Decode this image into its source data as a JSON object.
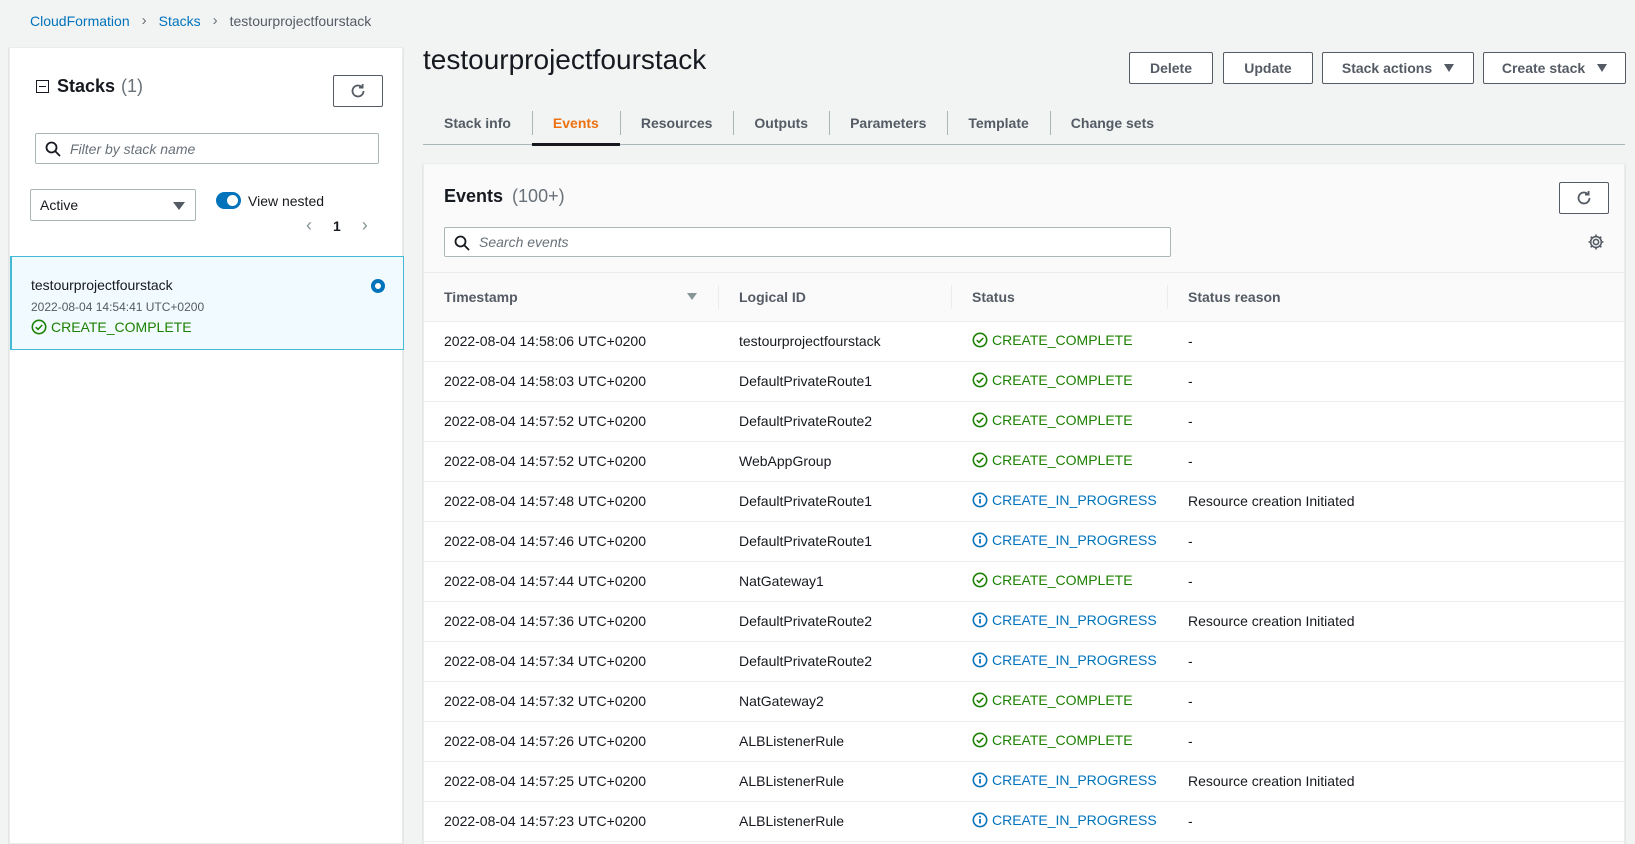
{
  "breadcrumb": {
    "root": "CloudFormation",
    "stacks": "Stacks",
    "current": "testourprojectfourstack"
  },
  "sidebar": {
    "title": "Stacks",
    "count": "(1)",
    "filter_placeholder": "Filter by stack name",
    "status_filter": "Active",
    "view_nested_label": "View nested",
    "page": "1",
    "stack": {
      "name": "testourprojectfourstack",
      "created": "2022-08-04 14:54:41 UTC+0200",
      "status": "CREATE_COMPLETE"
    }
  },
  "header": {
    "title": "testourprojectfourstack",
    "buttons": {
      "delete": "Delete",
      "update": "Update",
      "stack_actions": "Stack actions",
      "create_stack": "Create stack"
    }
  },
  "tabs": [
    "Stack info",
    "Events",
    "Resources",
    "Outputs",
    "Parameters",
    "Template",
    "Change sets"
  ],
  "active_tab": "Events",
  "events": {
    "title": "Events",
    "count": "(100+)",
    "search_placeholder": "Search events",
    "columns": [
      "Timestamp",
      "Logical ID",
      "Status",
      "Status reason"
    ],
    "rows": [
      {
        "timestamp": "2022-08-04 14:58:06 UTC+0200",
        "logical_id": "testourprojectfourstack",
        "status": "CREATE_COMPLETE",
        "reason": "-"
      },
      {
        "timestamp": "2022-08-04 14:58:03 UTC+0200",
        "logical_id": "DefaultPrivateRoute1",
        "status": "CREATE_COMPLETE",
        "reason": "-"
      },
      {
        "timestamp": "2022-08-04 14:57:52 UTC+0200",
        "logical_id": "DefaultPrivateRoute2",
        "status": "CREATE_COMPLETE",
        "reason": "-"
      },
      {
        "timestamp": "2022-08-04 14:57:52 UTC+0200",
        "logical_id": "WebAppGroup",
        "status": "CREATE_COMPLETE",
        "reason": "-"
      },
      {
        "timestamp": "2022-08-04 14:57:48 UTC+0200",
        "logical_id": "DefaultPrivateRoute1",
        "status": "CREATE_IN_PROGRESS",
        "reason": "Resource creation Initiated"
      },
      {
        "timestamp": "2022-08-04 14:57:46 UTC+0200",
        "logical_id": "DefaultPrivateRoute1",
        "status": "CREATE_IN_PROGRESS",
        "reason": "-"
      },
      {
        "timestamp": "2022-08-04 14:57:44 UTC+0200",
        "logical_id": "NatGateway1",
        "status": "CREATE_COMPLETE",
        "reason": "-"
      },
      {
        "timestamp": "2022-08-04 14:57:36 UTC+0200",
        "logical_id": "DefaultPrivateRoute2",
        "status": "CREATE_IN_PROGRESS",
        "reason": "Resource creation Initiated"
      },
      {
        "timestamp": "2022-08-04 14:57:34 UTC+0200",
        "logical_id": "DefaultPrivateRoute2",
        "status": "CREATE_IN_PROGRESS",
        "reason": "-"
      },
      {
        "timestamp": "2022-08-04 14:57:32 UTC+0200",
        "logical_id": "NatGateway2",
        "status": "CREATE_COMPLETE",
        "reason": "-"
      },
      {
        "timestamp": "2022-08-04 14:57:26 UTC+0200",
        "logical_id": "ALBListenerRule",
        "status": "CREATE_COMPLETE",
        "reason": "-"
      },
      {
        "timestamp": "2022-08-04 14:57:25 UTC+0200",
        "logical_id": "ALBListenerRule",
        "status": "CREATE_IN_PROGRESS",
        "reason": "Resource creation Initiated"
      },
      {
        "timestamp": "2022-08-04 14:57:23 UTC+0200",
        "logical_id": "ALBListenerRule",
        "status": "CREATE_IN_PROGRESS",
        "reason": "-"
      }
    ]
  },
  "colors": {
    "link": "#0073bb",
    "success": "#1d8102",
    "in_progress": "#0073bb",
    "active_tab": "#ec7211"
  }
}
